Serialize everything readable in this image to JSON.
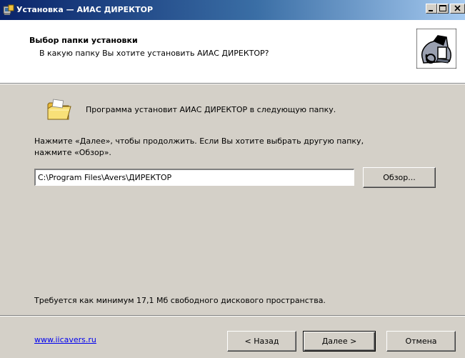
{
  "window": {
    "title": "Установка — АИАС ДИРЕКТОР"
  },
  "header": {
    "title": "Выбор папки установки",
    "subtitle": "В какую папку Вы хотите установить АИАС ДИРЕКТОР?"
  },
  "body": {
    "intro": "Программа установит АИАС ДИРЕКТОР в следующую папку.",
    "instruction_line1": "Нажмите «Далее», чтобы продолжить. Если Вы хотите выбрать другую папку,",
    "instruction_line2": "нажмите «Обзор».",
    "path_value": "C:\\Program Files\\Avers\\ДИРЕКТОР",
    "browse_label": "Обзор...",
    "space_requirement": "Требуется как минимум 17,1 Мб свободного дискового пространства."
  },
  "footer": {
    "link_text": "www.iicavers.ru",
    "back_label": "< Назад",
    "next_label": "Далее >",
    "cancel_label": "Отмена"
  },
  "icons": {
    "app": "installer-icon",
    "folder": "folder-icon",
    "header_image": "computer-install-icon"
  },
  "colors": {
    "titlebar_start": "#0a246a",
    "titlebar_end": "#a6caf0",
    "dialog_face": "#d4d0c8",
    "link": "#0000ee"
  }
}
